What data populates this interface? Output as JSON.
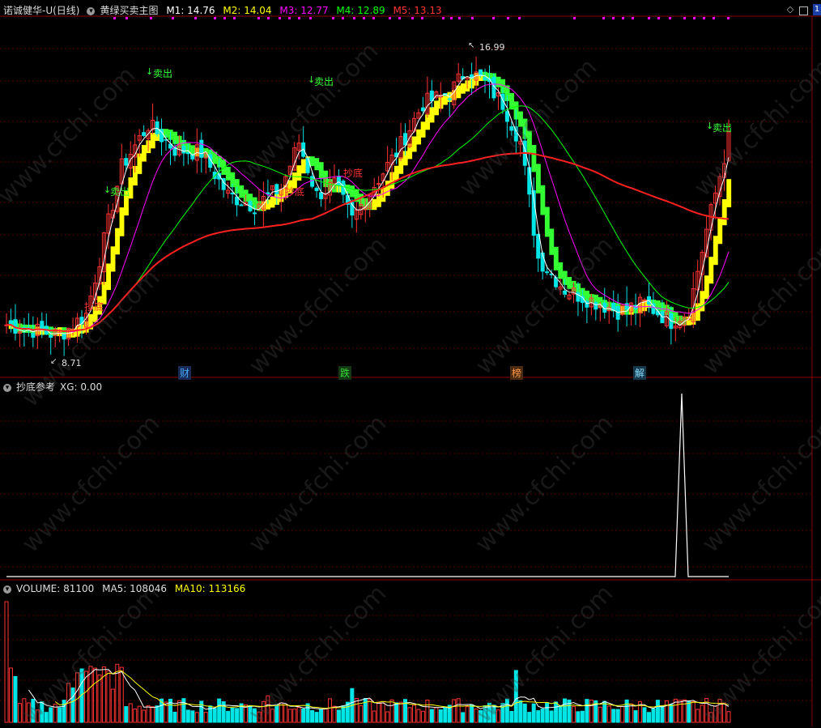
{
  "main_header": {
    "stock_name": "诺诚健华-U(日线)",
    "indicator": "黄绿买卖主图",
    "items": [
      {
        "label": "M1: 14.76",
        "color": "#ffffff"
      },
      {
        "label": "M2: 14.04",
        "color": "#ffff00"
      },
      {
        "label": "M3: 12.77",
        "color": "#ff00ff"
      },
      {
        "label": "M4: 12.89",
        "color": "#00ff00"
      },
      {
        "label": "M5: 13.13",
        "color": "#ff3333"
      }
    ]
  },
  "main_chart": {
    "price_high_label": "16.99",
    "price_low_label": "8.71",
    "signals": [
      {
        "text": "卖出",
        "color": "#33ff33"
      },
      {
        "text": "卖出",
        "color": "#33ff33"
      },
      {
        "text": "卖出",
        "color": "#33ff33"
      },
      {
        "text": "卖出",
        "color": "#33ff33"
      },
      {
        "text": "抄底",
        "color": "#ff3333"
      },
      {
        "text": "抄底",
        "color": "#ff3333"
      },
      {
        "text": "抄底",
        "color": "#ff3333"
      }
    ],
    "events": [
      {
        "text": "财",
        "color": "#44aaff"
      },
      {
        "text": "跌",
        "color": "#33dd33"
      },
      {
        "text": "榜",
        "color": "#ff9944"
      },
      {
        "text": "解",
        "color": "#88ddff"
      }
    ]
  },
  "sub_header": {
    "title": "抄底参考",
    "value": "XG: 0.00"
  },
  "vol_header": {
    "items": [
      {
        "label": "VOLUME: 81100",
        "color": "#dddddd"
      },
      {
        "label": "MA5: 108046",
        "color": "#dddddd"
      },
      {
        "label": "MA10: 113166",
        "color": "#ffff00"
      }
    ]
  },
  "window": {
    "badge": "1"
  },
  "watermark": "www.cfchi.com",
  "colors": {
    "up": "#ff3333",
    "down": "#00e5e5",
    "ma_white": "#ffffff",
    "ma_magenta": "#ff00ff",
    "ma_green": "#00ff00",
    "ma_red": "#ff2020",
    "band_yellow": "#ffff00",
    "band_green": "#33ff33",
    "grid": "#8b0000"
  }
}
